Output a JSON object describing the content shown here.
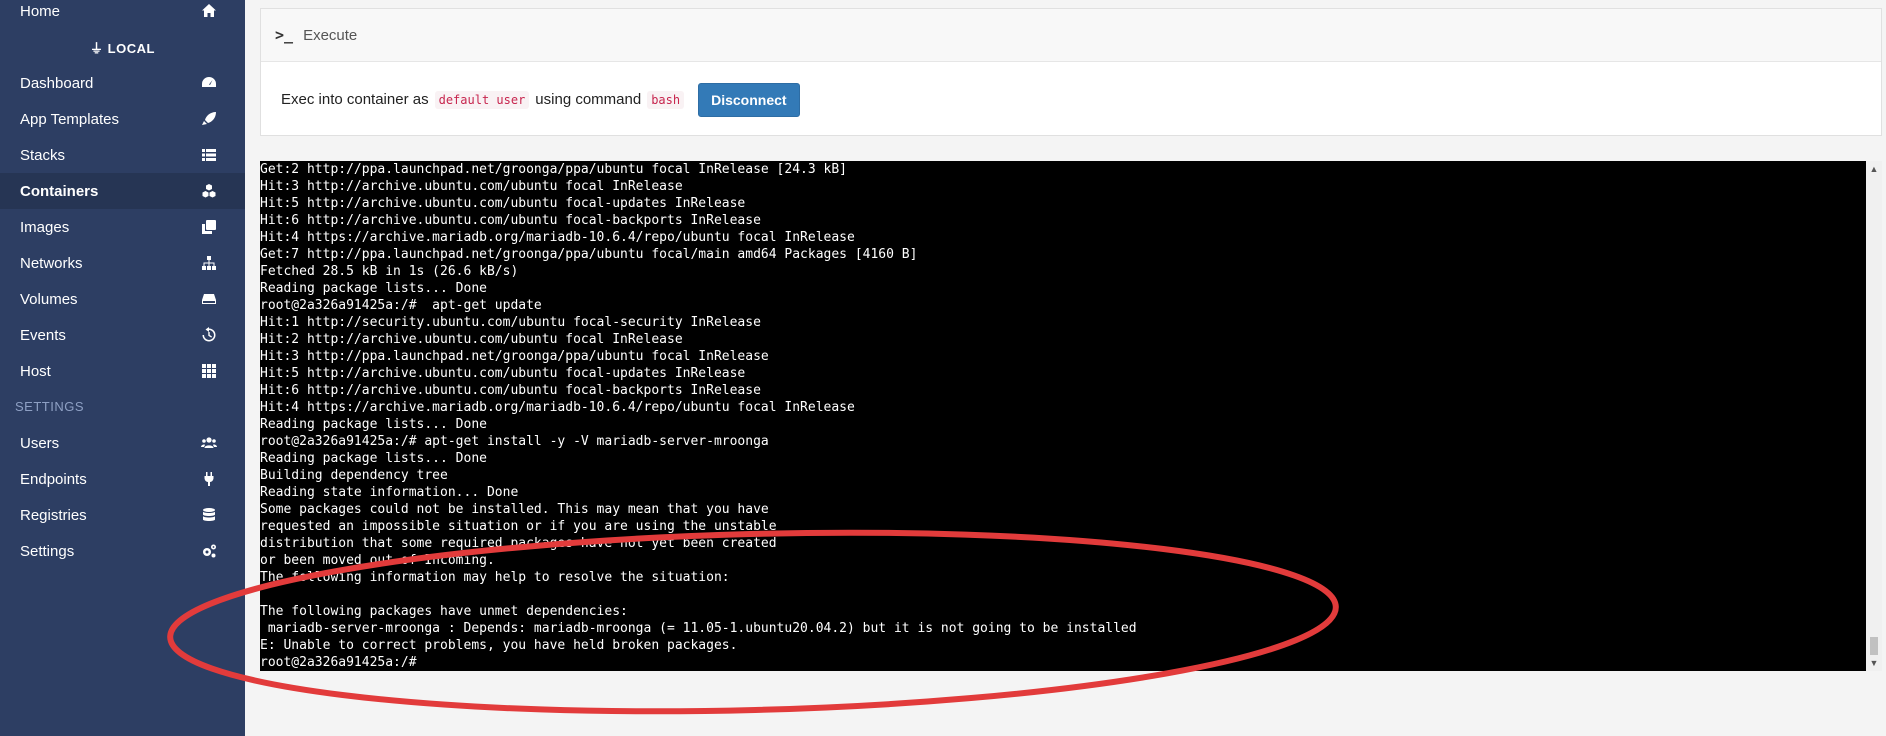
{
  "sidebar": {
    "home": "Home",
    "environment": "LOCAL",
    "items": [
      {
        "label": "Dashboard",
        "icon": "dashboard-icon"
      },
      {
        "label": "App Templates",
        "icon": "rocket-icon"
      },
      {
        "label": "Stacks",
        "icon": "list-icon"
      },
      {
        "label": "Containers",
        "icon": "cubes-icon"
      },
      {
        "label": "Images",
        "icon": "clone-icon"
      },
      {
        "label": "Networks",
        "icon": "sitemap-icon"
      },
      {
        "label": "Volumes",
        "icon": "hdd-icon"
      },
      {
        "label": "Events",
        "icon": "history-icon"
      },
      {
        "label": "Host",
        "icon": "th-icon"
      }
    ],
    "settings_title": "SETTINGS",
    "settings_items": [
      {
        "label": "Users",
        "icon": "users-icon"
      },
      {
        "label": "Endpoints",
        "icon": "plug-icon"
      },
      {
        "label": "Registries",
        "icon": "database-icon"
      },
      {
        "label": "Settings",
        "icon": "cogs-icon"
      }
    ],
    "active": "Containers"
  },
  "panel": {
    "header_icon": ">_",
    "title": "Execute",
    "text_before": "Exec into container as",
    "user_code": "default user",
    "text_middle": "using command",
    "command_code": "bash",
    "button": "Disconnect"
  },
  "terminal": {
    "lines": [
      "Get:2 http://ppa.launchpad.net/groonga/ppa/ubuntu focal InRelease [24.3 kB]",
      "Hit:3 http://archive.ubuntu.com/ubuntu focal InRelease",
      "Hit:5 http://archive.ubuntu.com/ubuntu focal-updates InRelease",
      "Hit:6 http://archive.ubuntu.com/ubuntu focal-backports InRelease",
      "Hit:4 https://archive.mariadb.org/mariadb-10.6.4/repo/ubuntu focal InRelease",
      "Get:7 http://ppa.launchpad.net/groonga/ppa/ubuntu focal/main amd64 Packages [4160 B]",
      "Fetched 28.5 kB in 1s (26.6 kB/s)",
      "Reading package lists... Done",
      "root@2a326a91425a:/#  apt-get update",
      "Hit:1 http://security.ubuntu.com/ubuntu focal-security InRelease",
      "Hit:2 http://archive.ubuntu.com/ubuntu focal InRelease",
      "Hit:3 http://ppa.launchpad.net/groonga/ppa/ubuntu focal InRelease",
      "Hit:5 http://archive.ubuntu.com/ubuntu focal-updates InRelease",
      "Hit:6 http://archive.ubuntu.com/ubuntu focal-backports InRelease",
      "Hit:4 https://archive.mariadb.org/mariadb-10.6.4/repo/ubuntu focal InRelease",
      "Reading package lists... Done",
      "root@2a326a91425a:/# apt-get install -y -V mariadb-server-mroonga",
      "Reading package lists... Done",
      "Building dependency tree",
      "Reading state information... Done",
      "Some packages could not be installed. This may mean that you have",
      "requested an impossible situation or if you are using the unstable",
      "distribution that some required packages have not yet been created",
      "or been moved out of Incoming.",
      "The following information may help to resolve the situation:",
      "",
      "The following packages have unmet dependencies:",
      " mariadb-server-mroonga : Depends: mariadb-mroonga (= 11.05-1.ubuntu20.04.2) but it is not going to be installed",
      "E: Unable to correct problems, you have held broken packages.",
      "root@2a326a91425a:/# "
    ]
  },
  "colors": {
    "sidebar_bg": "#2d3e63",
    "button_bg": "#337ab7",
    "annotation": "#e23b3b"
  }
}
